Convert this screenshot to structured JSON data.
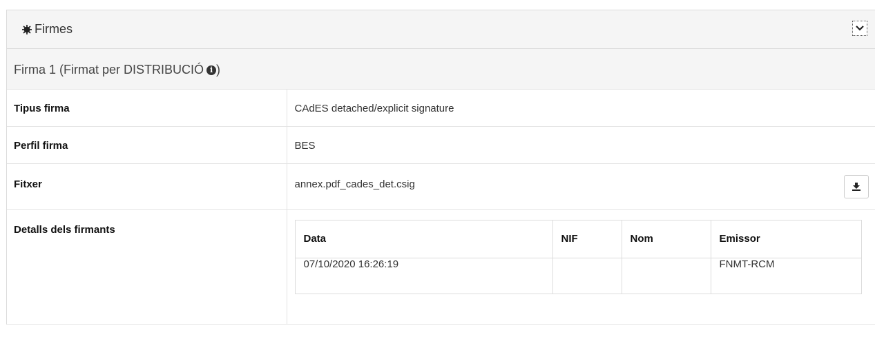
{
  "panel": {
    "title": "Firmes",
    "icons": {
      "title": "gear-icon",
      "collapse": "chevron-down-icon"
    }
  },
  "signature": {
    "heading": "Firma 1 (Firmat per DISTRIBUCIÓ",
    "heading_close": ")",
    "info_icon": "i",
    "rows": [
      {
        "label": "Tipus firma",
        "value": "CAdES detached/explicit signature"
      },
      {
        "label": "Perfil firma",
        "value": "BES"
      },
      {
        "label": "Fitxer",
        "value": "annex.pdf_cades_det.csig"
      },
      {
        "label": "Detalls dels firmants"
      }
    ],
    "download_icon": "download-icon"
  },
  "signers": {
    "headers": [
      "Data",
      "NIF",
      "Nom",
      "Emissor"
    ],
    "rows": [
      [
        "07/10/2020 16:26:19",
        "",
        "",
        "FNMT-RCM"
      ]
    ]
  }
}
